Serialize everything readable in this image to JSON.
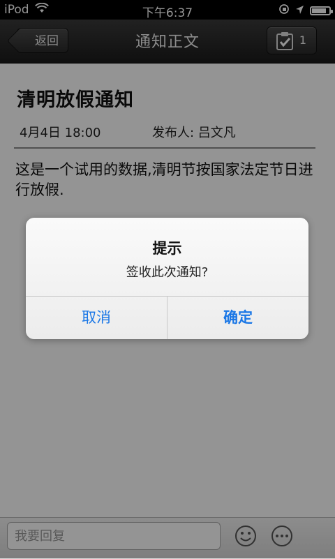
{
  "status_bar": {
    "device": "iPod",
    "time": "下午6:37",
    "battery_level": 0.85
  },
  "nav": {
    "back_label": "返回",
    "title": "通知正文",
    "sign_count": "1"
  },
  "notice": {
    "title": "清明放假通知",
    "date": "4月4日 18:00",
    "publisher": "发布人: 吕文凡",
    "body": "这是一个试用的数据,清明节按国家法定节日进行放假."
  },
  "reply": {
    "placeholder": "我要回复"
  },
  "dialog": {
    "title": "提示",
    "message": "签收此次通知?",
    "cancel_label": "取消",
    "confirm_label": "确定"
  },
  "colors": {
    "accent": "#1a77e6",
    "navbar": "#2a2a2a"
  }
}
